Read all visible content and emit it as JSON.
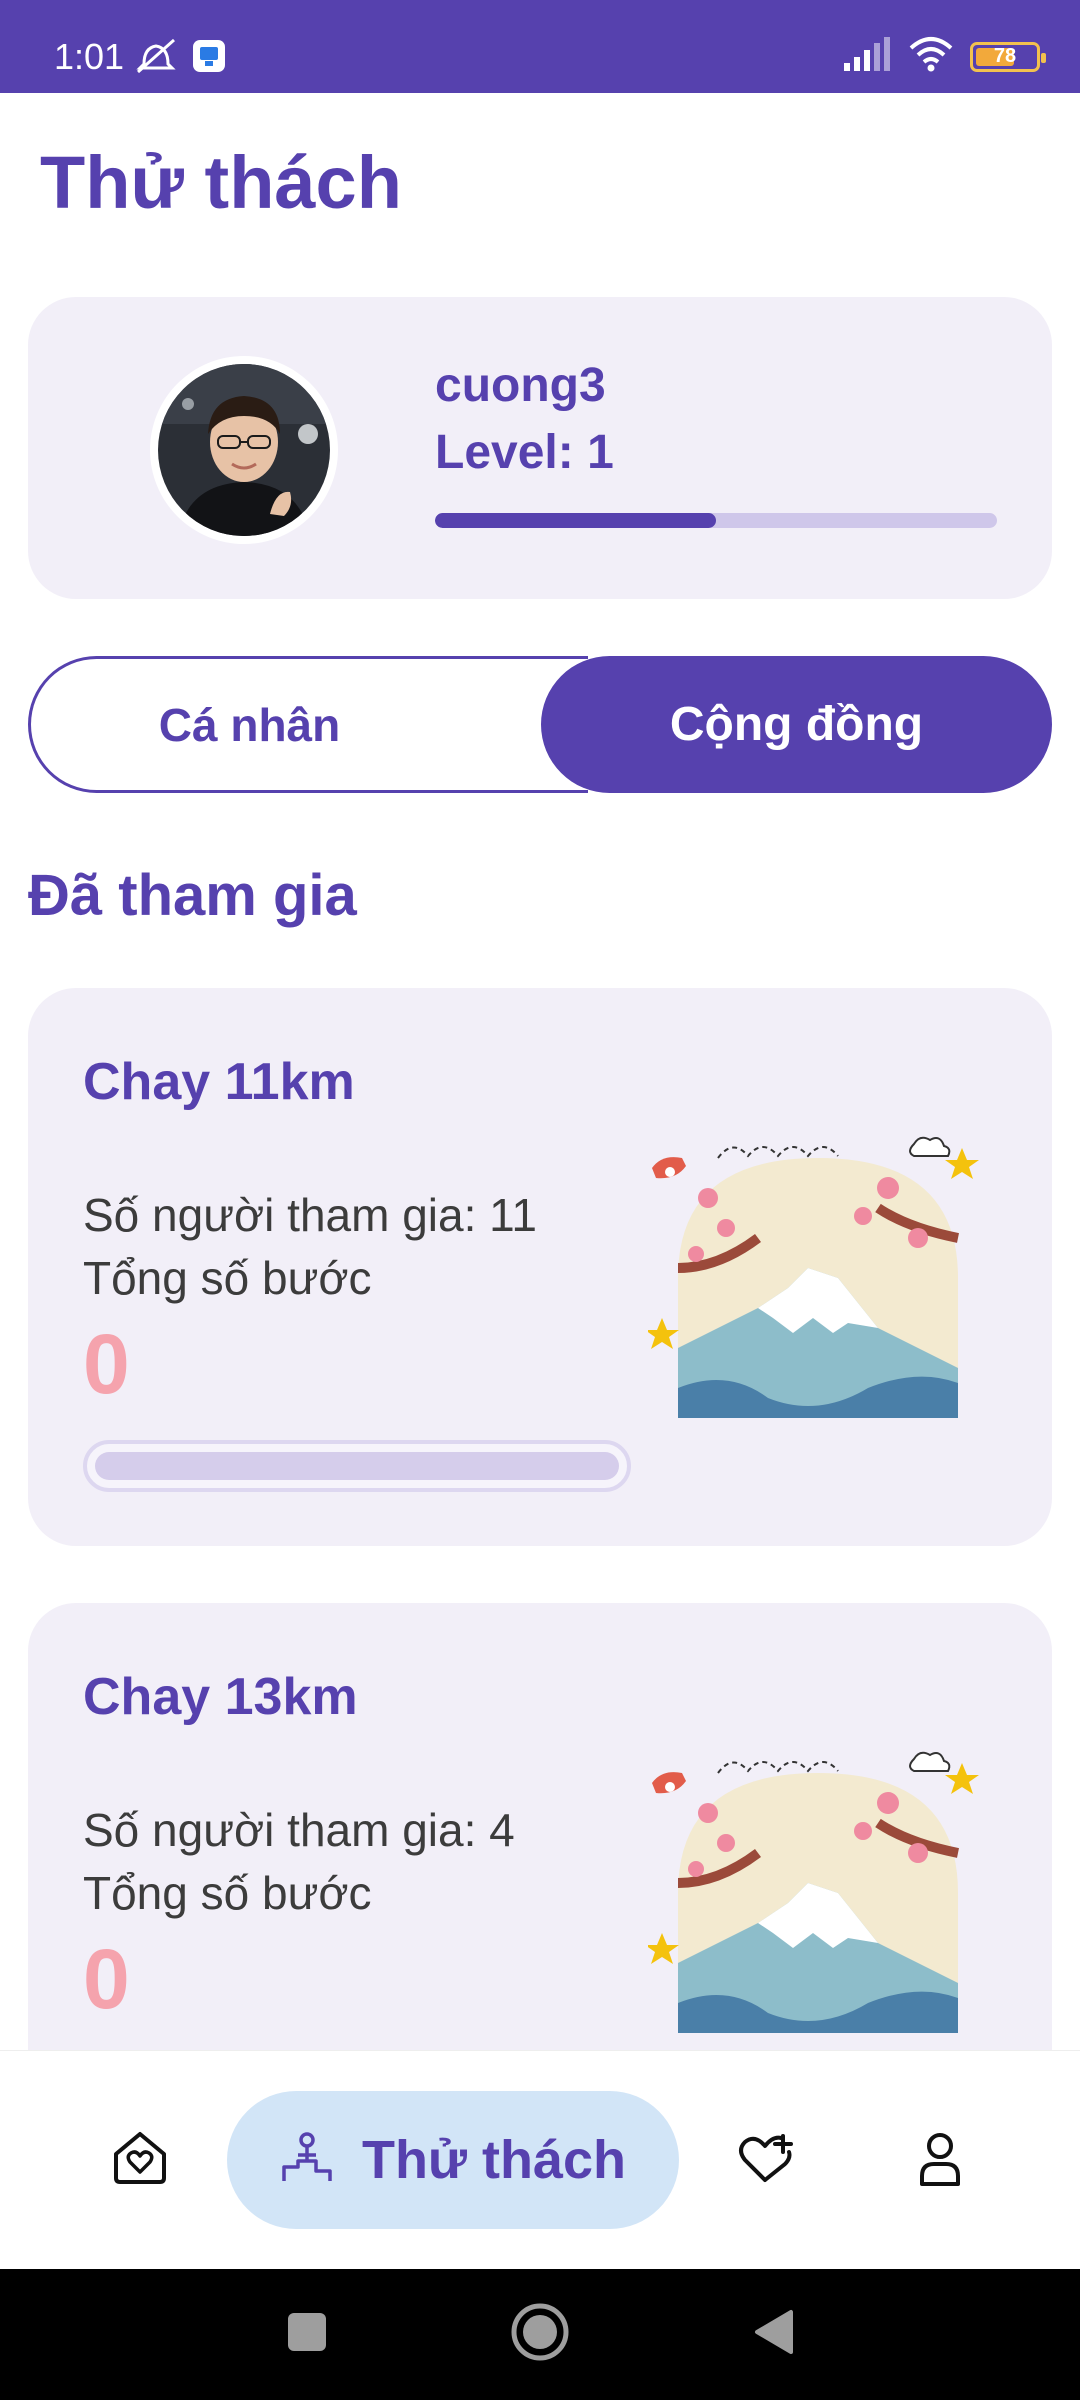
{
  "status_bar": {
    "time": "1:01",
    "battery": "78",
    "icons": [
      "mute-alarm-icon",
      "app-notification-icon",
      "signal-icon",
      "wifi-icon",
      "battery-icon"
    ]
  },
  "page": {
    "title": "Thử thách"
  },
  "profile": {
    "username": "cuong3",
    "level_label": "Level: 1",
    "level_progress": 0.5
  },
  "tabs": [
    {
      "label": "Cá nhân",
      "selected": false
    },
    {
      "label": "Cộng đồng",
      "selected": true
    }
  ],
  "section": {
    "title": "Đã tham gia"
  },
  "challenges": [
    {
      "title": "Chay 11km",
      "participants": "Số người tham gia: 11",
      "steps_label": "Tổng số bước",
      "steps_value": "0",
      "progress": 0
    },
    {
      "title": "Chay 13km",
      "participants": "Số người tham gia: 4",
      "steps_label": "Tổng số bước",
      "steps_value": "0",
      "progress": 0
    }
  ],
  "bottom_nav": {
    "items": [
      {
        "icon": "home-heart-icon",
        "label": ""
      },
      {
        "icon": "challenge-podium-icon",
        "label": "Thử thách",
        "active": true
      },
      {
        "icon": "heart-plus-icon",
        "label": ""
      },
      {
        "icon": "user-icon",
        "label": ""
      }
    ]
  },
  "colors": {
    "primary": "#5641ae",
    "card_bg": "#f2eff8",
    "accent_pink": "#f5a3ad",
    "nav_active_bg": "#d2e5f7"
  }
}
